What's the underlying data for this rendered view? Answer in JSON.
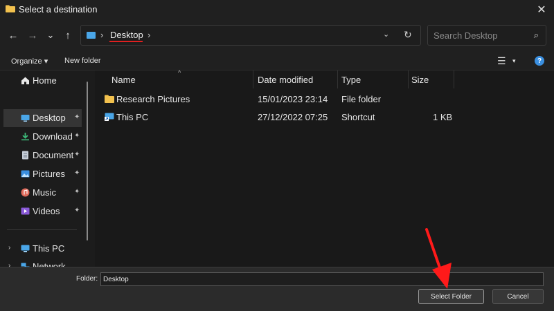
{
  "window": {
    "title": "Select a destination",
    "close_glyph": "✕"
  },
  "nav": {
    "back_glyph": "←",
    "forward_glyph": "→",
    "recent_glyph": "⌄",
    "up_glyph": "↑"
  },
  "address": {
    "sep": "›",
    "crumb": "Desktop",
    "dropdown_glyph": "⌄",
    "refresh_glyph": "↻"
  },
  "search": {
    "placeholder": "Search Desktop",
    "icon_glyph": "⌕"
  },
  "toolbar": {
    "organize_label": "Organize ▾",
    "new_folder_label": "New folder",
    "view_glyph": "☰",
    "view_dd_glyph": "▾",
    "help_glyph": "?"
  },
  "sidebar": {
    "pin_glyph": "📌",
    "expand_glyph": "›",
    "items": [
      {
        "label": "Home",
        "icon": "home-icon",
        "color": "#e8e8e8"
      },
      {
        "label": "Desktop",
        "icon": "desktop-icon",
        "color": "#4aa6e8"
      },
      {
        "label": "Download",
        "icon": "downloads-icon",
        "color": "#3cb878"
      },
      {
        "label": "Document",
        "icon": "documents-icon",
        "color": "#c8d0da"
      },
      {
        "label": "Pictures",
        "icon": "pictures-icon",
        "color": "#3a8fe0"
      },
      {
        "label": "Music",
        "icon": "music-icon",
        "color": "#e06a5a"
      },
      {
        "label": "Videos",
        "icon": "videos-icon",
        "color": "#8a5ad8"
      },
      {
        "label": "This PC",
        "icon": "this-pc-icon",
        "color": "#4aa6e8"
      },
      {
        "label": "Network",
        "icon": "network-icon",
        "color": "#4aa6e8"
      }
    ]
  },
  "files": {
    "sort_glyph": "^",
    "columns": [
      "Name",
      "Date modified",
      "Type",
      "Size"
    ],
    "rows": [
      {
        "name": "Research Pictures",
        "date": "15/01/2023 23:14",
        "type": "File folder",
        "size": "",
        "icon": "folder-icon"
      },
      {
        "name": "This PC",
        "date": "27/12/2022 07:25",
        "type": "Shortcut",
        "size": "1 KB",
        "icon": "shortcut-icon"
      }
    ]
  },
  "footer": {
    "folder_label": "Folder:",
    "folder_value": "Desktop",
    "select_label": "Select Folder",
    "cancel_label": "Cancel"
  },
  "colors": {
    "accent": "#3a8fe0",
    "annotation_red": "#ff1a1a",
    "folder_yellow": "#f2c14e"
  }
}
